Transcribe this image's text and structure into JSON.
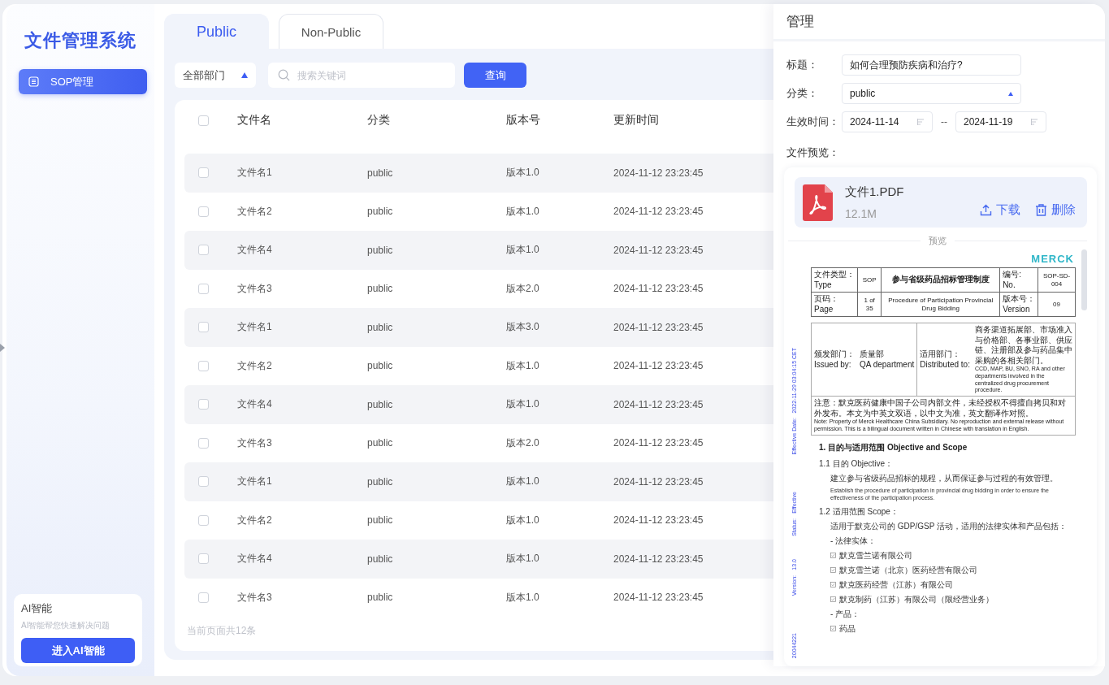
{
  "sidebar": {
    "title": "文件管理系统",
    "menu": [
      {
        "label": "SOP管理",
        "selected": true
      }
    ],
    "ai_card": {
      "title": "AI智能",
      "subtitle": "AI智能帮您快速解决问题",
      "button": "进入AI智能"
    }
  },
  "tabs": [
    {
      "label": "Public",
      "selected": true
    },
    {
      "label": "Non-Public",
      "selected": false
    }
  ],
  "filters": {
    "department": "全部部门",
    "search_placeholder": "搜索关键词",
    "query_button": "查询"
  },
  "table": {
    "columns": [
      "文件名",
      "分类",
      "版本号",
      "更新时间"
    ],
    "header_checked": false,
    "rows": [
      {
        "name": "文件名1",
        "category": "public",
        "version": "版本1.0",
        "updated": "2024-11-12 23:23:45",
        "checked": false
      },
      {
        "name": "文件名2",
        "category": "public",
        "version": "版本1.0",
        "updated": "2024-11-12 23:23:45",
        "checked": false
      },
      {
        "name": "文件名4",
        "category": "public",
        "version": "版本1.0",
        "updated": "2024-11-12 23:23:45",
        "checked": false
      },
      {
        "name": "文件名3",
        "category": "public",
        "version": "版本2.0",
        "updated": "2024-11-12 23:23:45",
        "checked": false
      },
      {
        "name": "文件名1",
        "category": "public",
        "version": "版本3.0",
        "updated": "2024-11-12 23:23:45",
        "checked": false
      },
      {
        "name": "文件名2",
        "category": "public",
        "version": "版本1.0",
        "updated": "2024-11-12 23:23:45",
        "checked": false
      },
      {
        "name": "文件名4",
        "category": "public",
        "version": "版本1.0",
        "updated": "2024-11-12 23:23:45",
        "checked": false
      },
      {
        "name": "文件名3",
        "category": "public",
        "version": "版本2.0",
        "updated": "2024-11-12 23:23:45",
        "checked": false
      },
      {
        "name": "文件名1",
        "category": "public",
        "version": "版本1.0",
        "updated": "2024-11-12 23:23:45",
        "checked": false
      },
      {
        "name": "文件名2",
        "category": "public",
        "version": "版本1.0",
        "updated": "2024-11-12 23:23:45",
        "checked": false
      },
      {
        "name": "文件名4",
        "category": "public",
        "version": "版本1.0",
        "updated": "2024-11-12 23:23:45",
        "checked": false
      },
      {
        "name": "文件名3",
        "category": "public",
        "version": "版本1.0",
        "updated": "2024-11-12 23:23:45",
        "checked": false
      }
    ],
    "footer": "当前页面共12条"
  },
  "drawer": {
    "title": "管理",
    "fields": [
      {
        "kind": "text",
        "label": "标题：",
        "value": "如何合理预防疾病和治疗?"
      },
      {
        "kind": "select",
        "label": "分类：",
        "value": "public"
      },
      {
        "kind": "daterange",
        "label": "生效时间：",
        "start": "2024-11-14",
        "separator": "--",
        "end": "2024-11-19"
      }
    ],
    "preview_label": "文件预览：",
    "file": {
      "name": "文件1.PDF",
      "size": "12.1M",
      "download": "下载",
      "delete": "删除"
    },
    "preview_divider": "预览",
    "document": {
      "logo": "MERCK",
      "stamp": [
        "20044221",
        "Version:",
        "13.0",
        "Status:",
        "Effective",
        "Effective Date:",
        "2022-11-29 03:04:15 CET"
      ],
      "header_table": [
        [
          "文件类型：\nType",
          "SOP",
          "参与省级药品招标管理制度",
          "编号:\nNo.",
          "SOP-SD-004"
        ],
        [
          "页码：\nPage",
          "1 of 35",
          "Procedure of Participation Provincial Drug Bidding",
          "版本号：\nVersion",
          "09"
        ]
      ],
      "issued_label": "颁发部门：\nIssued by:",
      "issued_value": "质量部\nQA department",
      "distributed_label": "适用部门：\nDistributed to:",
      "distributed_zh": "商务渠道拓展部、市场准入与价格部、各事业部、供应链、注册部及参与药品集中采购的各相关部门。",
      "distributed_en": "CCD, MAP, BU, SNO, RA and other departments involved in the centralized drug procurement procedure.",
      "note_zh": "注意：默克医药健康中国子公司内部文件，未经授权不得擅自拷贝和对外发布。本文为中英文双语，以中文为准，英文翻译作对照。",
      "note_en": "Note: Property of Merck Healthcare China Subsidiary. No reproduction and external release without permission. This is a bilingual document written in Chinese with translation in English.",
      "blocks": [
        {
          "kind": "heading",
          "text": "1. 目的与适用范围  Objective and Scope"
        },
        {
          "kind": "subheading",
          "text": "1.1  目的 Objective："
        },
        {
          "kind": "para_zh",
          "text": "建立参与省级药品招标的规程，从而保证参与过程的有效管理。"
        },
        {
          "kind": "para_en",
          "text": "Establish the procedure of participation in provincial drug bidding in order to ensure the effectiveness of the participation process."
        },
        {
          "kind": "subheading",
          "text": "1.2  适用范围  Scope："
        },
        {
          "kind": "para_zh",
          "text": "适用于默克公司的 GDP/GSP 活动，适用的法律实体和产品包括："
        },
        {
          "kind": "dash",
          "text": "-  法律实体："
        },
        {
          "kind": "check",
          "text": "默克雪兰诺有限公司"
        },
        {
          "kind": "check",
          "text": "默克雪兰诺（北京）医药经营有限公司"
        },
        {
          "kind": "check",
          "text": "默克医药经营（江苏）有限公司"
        },
        {
          "kind": "check",
          "text": "默克制药（江苏）有限公司（限经营业务）"
        },
        {
          "kind": "dash",
          "text": "-  产品："
        },
        {
          "kind": "check",
          "text": "药品"
        }
      ]
    }
  }
}
